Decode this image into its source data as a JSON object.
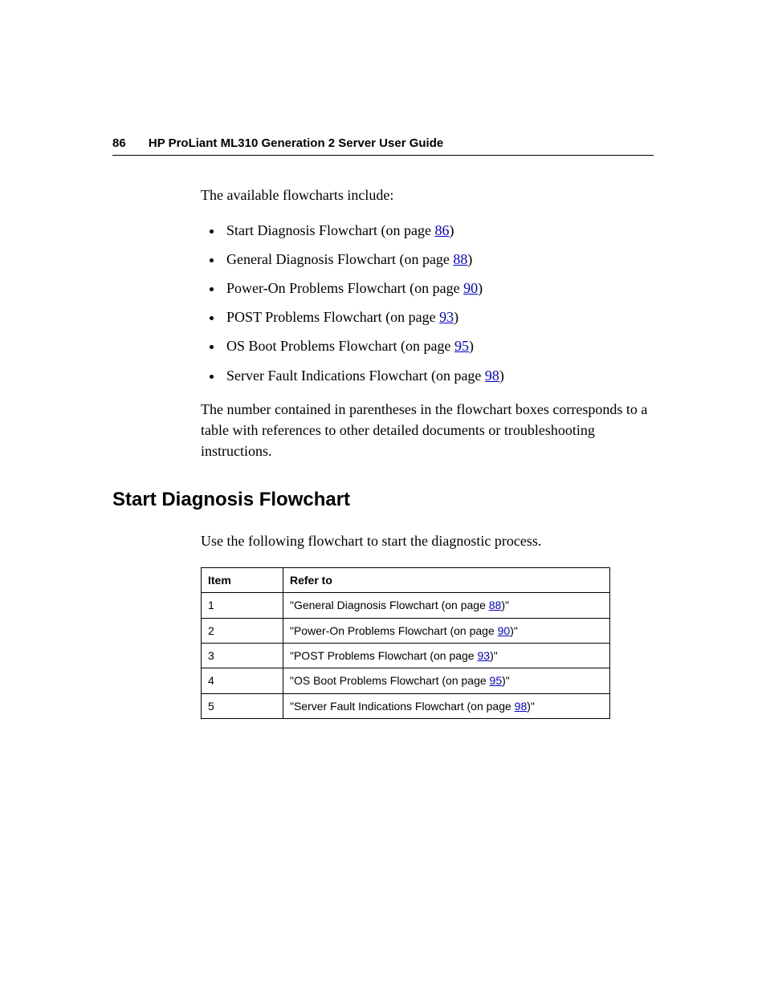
{
  "header": {
    "page_number": "86",
    "title": "HP ProLiant ML310 Generation 2 Server User Guide"
  },
  "intro": "The available flowcharts include:",
  "list": [
    {
      "before": "Start Diagnosis Flowchart (on page ",
      "link": "86",
      "after": ")"
    },
    {
      "before": "General Diagnosis Flowchart (on page ",
      "link": "88",
      "after": ")"
    },
    {
      "before": "Power-On Problems Flowchart (on page ",
      "link": "90",
      "after": ")"
    },
    {
      "before": "POST Problems Flowchart (on page ",
      "link": "93",
      "after": ")"
    },
    {
      "before": "OS Boot Problems Flowchart (on page ",
      "link": "95",
      "after": ")"
    },
    {
      "before": "Server Fault Indications Flowchart (on page ",
      "link": "98",
      "after": ")"
    }
  ],
  "explain": "The number contained in parentheses in the flowchart boxes corresponds to a table with references to other detailed documents or troubleshooting instructions.",
  "section_heading": "Start Diagnosis Flowchart",
  "sub_para": "Use the following flowchart to start the diagnostic process.",
  "table": {
    "headers": {
      "item": "Item",
      "refer": "Refer to"
    },
    "rows": [
      {
        "item": "1",
        "before": "\"General Diagnosis Flowchart (on page ",
        "link": "88",
        "after": ")\""
      },
      {
        "item": "2",
        "before": "\"Power-On Problems Flowchart (on page ",
        "link": "90",
        "after": ")\""
      },
      {
        "item": "3",
        "before": "\"POST Problems Flowchart (on page ",
        "link": "93",
        "after": ")\""
      },
      {
        "item": "4",
        "before": "\"OS Boot Problems Flowchart (on page ",
        "link": "95",
        "after": ")\""
      },
      {
        "item": "5",
        "before": "\"Server Fault Indications Flowchart (on page ",
        "link": "98",
        "after": ")\""
      }
    ]
  }
}
